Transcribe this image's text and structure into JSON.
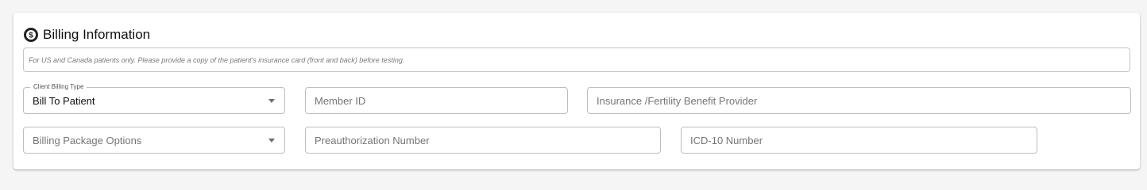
{
  "section": {
    "title": "Billing Information",
    "icon": "dollar-circle-icon",
    "note": "For US and Canada patients only. Please provide a copy of the patient's insurance card (front and back) before testing."
  },
  "fields": {
    "client_billing_type": {
      "label": "Client Billing Type",
      "value": "Bill To Patient"
    },
    "member_id": {
      "placeholder": "Member ID"
    },
    "insurance_provider": {
      "placeholder": "Insurance /Fertility Benefit Provider"
    },
    "billing_package": {
      "placeholder": "Billing Package Options"
    },
    "preauthorization": {
      "placeholder": "Preauthorization Number"
    },
    "icd10": {
      "placeholder": "ICD-10 Number"
    }
  }
}
